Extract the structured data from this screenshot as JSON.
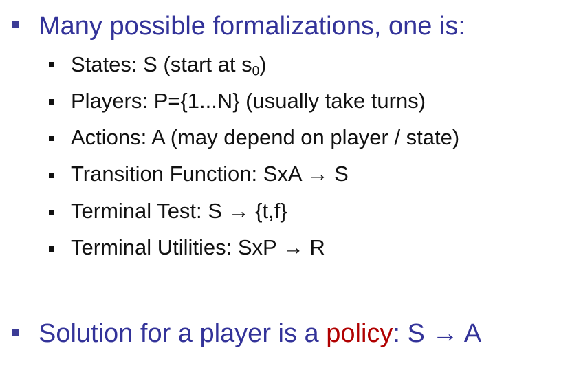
{
  "colors": {
    "heading": "#333399",
    "body": "#111111",
    "highlight": "#b00000"
  },
  "main_bullet": {
    "text": "Many possible formalizations, one is:"
  },
  "sub_bullets": {
    "states": {
      "prefix": "States: S (start at s",
      "subscript": "0",
      "suffix": ")"
    },
    "players": {
      "text": "Players: P={1...N} (usually take turns)"
    },
    "actions": {
      "text": "Actions: A (may depend on player / state)"
    },
    "transition": {
      "text": "Transition Function: SxA → S"
    },
    "terminal_test": {
      "text": "Terminal Test: S → {t,f}"
    },
    "terminal_utilities": {
      "text": "Terminal Utilities: SxP → R"
    }
  },
  "solution_bullet": {
    "prefix": "Solution for a player is a ",
    "highlight": "policy",
    "suffix": ": S → A"
  }
}
